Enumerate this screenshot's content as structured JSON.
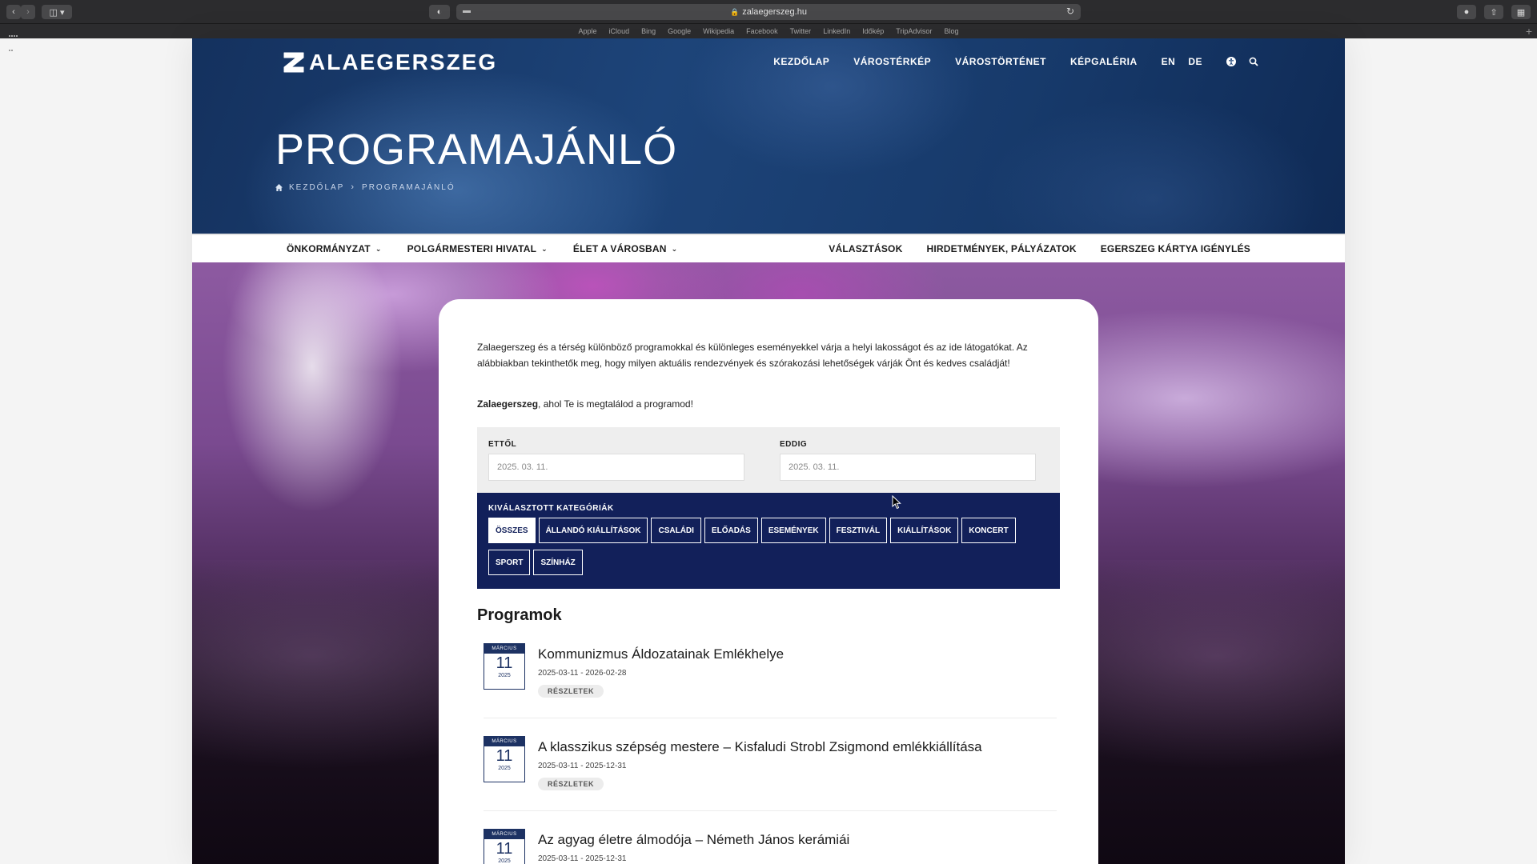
{
  "browser": {
    "url": "zalaegerszeg.hu",
    "favorites": [
      "Apple",
      "iCloud",
      "Bing",
      "Google",
      "Wikipedia",
      "Facebook",
      "Twitter",
      "LinkedIn",
      "Időkép",
      "TripAdvisor",
      "Blog"
    ]
  },
  "header": {
    "logo_text": "ALAEGERSZEG",
    "nav": [
      "KEZDŐLAP",
      "VÁROSTÉRKÉP",
      "VÁROSTÖRTÉNET",
      "KÉPGALÉRIA"
    ],
    "langs": [
      "EN",
      "DE"
    ],
    "title": "PROGRAMAJÁNLÓ",
    "breadcrumb": {
      "home": "KEZDŐLAP",
      "current": "PROGRAMAJÁNLÓ"
    }
  },
  "subnav": {
    "left": [
      "ÖNKORMÁNYZAT",
      "POLGÁRMESTERI HIVATAL",
      "ÉLET A VÁROSBAN"
    ],
    "right": [
      "VÁLASZTÁSOK",
      "HIRDETMÉNYEK, PÁLYÁZATOK",
      "EGERSZEG KÁRTYA IGÉNYLÉS"
    ]
  },
  "content": {
    "intro": "Zalaegerszeg és a térség különböző programokkal és különleges eseményekkel várja a helyi lakosságot és az ide látogatókat. Az alábbiakban tekinthetők meg, hogy milyen aktuális rendezvények és szórakozási lehetőségek várják Önt és kedves családját!",
    "intro2_bold": "Zalaegerszeg",
    "intro2_rest": ", ahol Te is megtalálod a programod!",
    "from_label": "ETTŐL",
    "from_value": "2025. 03. 11.",
    "to_label": "EDDIG",
    "to_value": "2025. 03. 11.",
    "categories_label": "KIVÁLASZTOTT KATEGÓRIÁK",
    "categories": [
      "ÖSSZES",
      "ÁLLANDÓ KIÁLLÍTÁSOK",
      "CSALÁDI",
      "ELŐADÁS",
      "ESEMÉNYEK",
      "FESZTIVÁL",
      "KIÁLLÍTÁSOK",
      "KONCERT",
      "SPORT",
      "SZÍNHÁZ"
    ],
    "active_category": "ÖSSZES",
    "programs_title": "Programok",
    "details_label": "RÉSZLETEK",
    "programs": [
      {
        "month": "MÁRCIUS",
        "day": "11",
        "year": "2025",
        "name": "Kommunizmus Áldozatainak Emlékhelye",
        "dates": "2025-03-11 - 2026-02-28"
      },
      {
        "month": "MÁRCIUS",
        "day": "11",
        "year": "2025",
        "name": "A klasszikus szépség mestere – Kisfaludi Strobl Zsigmond emlékkiállítása",
        "dates": "2025-03-11 - 2025-12-31"
      },
      {
        "month": "MÁRCIUS",
        "day": "11",
        "year": "2025",
        "name": "Az agyag életre álmodója – Németh János kerámiái",
        "dates": "2025-03-11 - 2025-12-31"
      }
    ]
  },
  "colors": {
    "navy": "#12205a",
    "hero": "#1d4479",
    "cal": "#1d3263"
  }
}
